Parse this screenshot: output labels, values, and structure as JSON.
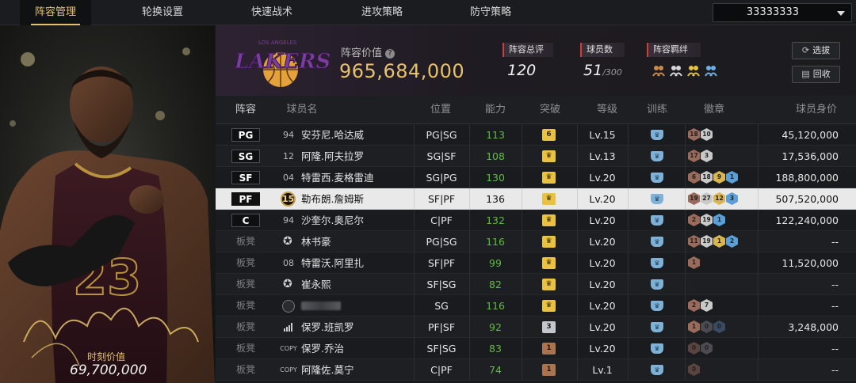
{
  "tabs": [
    {
      "label": "阵容管理",
      "active": true
    },
    {
      "label": "轮换设置",
      "active": false
    },
    {
      "label": "快速战术",
      "active": false
    },
    {
      "label": "进攻策略",
      "active": false
    },
    {
      "label": "防守策略",
      "active": false
    }
  ],
  "lineup_select": {
    "value": "33333333"
  },
  "featured_card": {
    "value_label": "时刻价值",
    "value": "69,700,000",
    "jersey": "23"
  },
  "team": {
    "logo_text": "LAKERS",
    "logo_sub": "LOS ANGELES",
    "lineup_value_label": "阵容价值",
    "lineup_value_help": "?",
    "lineup_value": "965,684,000",
    "rating_label": "阵容总评",
    "rating": "120",
    "player_count_label": "球员数",
    "player_count": "51",
    "player_count_max": "/300",
    "bonds_label": "阵容羁绊",
    "bond_icons": [
      "bond-icon-orange",
      "bond-icon-white",
      "bond-icon-gold",
      "bond-icon-blue"
    ]
  },
  "buttons": {
    "select_label": "选拔",
    "recycle_label": "回收"
  },
  "table": {
    "headers": {
      "lineup": "阵容",
      "name": "球员名",
      "position": "位置",
      "ability": "能力",
      "breakthrough": "突破",
      "level": "等级",
      "training": "训练",
      "badges": "徽章",
      "value": "球员身价"
    },
    "rows": [
      {
        "slot": "PG",
        "starter": true,
        "jersey": "94",
        "jersey_style": "plain",
        "name": "安芬尼.哈达威",
        "position": "PG|SG",
        "ability": "113",
        "break": "6",
        "break_style": "gold",
        "level": "Lv.15",
        "badges": [
          {
            "n": "18",
            "c": "#9a6a5a"
          },
          {
            "n": "10",
            "c": "#c9c9c9"
          }
        ],
        "value": "45,120,000"
      },
      {
        "slot": "SG",
        "starter": true,
        "jersey": "12",
        "jersey_style": "plain",
        "name": "阿隆.阿夫拉罗",
        "position": "SG|SF",
        "ability": "108",
        "break": "♛",
        "break_style": "gold",
        "level": "Lv.13",
        "badges": [
          {
            "n": "17",
            "c": "#9a6a5a"
          },
          {
            "n": "3",
            "c": "#c9c9c9"
          }
        ],
        "value": "17,536,000"
      },
      {
        "slot": "SF",
        "starter": true,
        "jersey": "04",
        "jersey_style": "plain",
        "name": "特雷西.麦格雷迪",
        "position": "SG|PG",
        "ability": "130",
        "break": "♛",
        "break_style": "gold",
        "level": "Lv.20",
        "badges": [
          {
            "n": "6",
            "c": "#9a6a5a"
          },
          {
            "n": "18",
            "c": "#c9c9c9"
          },
          {
            "n": "9",
            "c": "#d9b64f"
          },
          {
            "n": "1",
            "c": "#5a9fd6"
          }
        ],
        "value": "188,800,000"
      },
      {
        "slot": "PF",
        "starter": true,
        "selected": true,
        "jersey": "15",
        "jersey_style": "gold",
        "name": "勒布朗.詹姆斯",
        "position": "SF|PF",
        "ability": "136",
        "break": "♛",
        "break_style": "gold",
        "level": "Lv.20",
        "badges": [
          {
            "n": "19",
            "c": "#9a6a5a"
          },
          {
            "n": "27",
            "c": "#c9c9c9"
          },
          {
            "n": "12",
            "c": "#d9b64f"
          },
          {
            "n": "3",
            "c": "#5a9fd6"
          }
        ],
        "value": "507,520,000"
      },
      {
        "slot": "C",
        "starter": true,
        "jersey": "94",
        "jersey_style": "plain",
        "name": "沙奎尔.奥尼尔",
        "position": "C|PF",
        "ability": "132",
        "break": "♛",
        "break_style": "gold",
        "level": "Lv.20",
        "badges": [
          {
            "n": "2",
            "c": "#9a6a5a"
          },
          {
            "n": "19",
            "c": "#c9c9c9"
          },
          {
            "n": "1",
            "c": "#5a9fd6"
          }
        ],
        "value": "122,240,000"
      },
      {
        "slot": "板凳",
        "starter": false,
        "jersey": "",
        "jersey_style": "star",
        "name": "林书豪",
        "position": "PG|SG",
        "ability": "116",
        "break": "♛",
        "break_style": "gold",
        "level": "Lv.20",
        "badges": [
          {
            "n": "11",
            "c": "#9a6a5a"
          },
          {
            "n": "19",
            "c": "#c9c9c9"
          },
          {
            "n": "1",
            "c": "#d9b64f"
          },
          {
            "n": "2",
            "c": "#5a9fd6"
          }
        ],
        "value": "--"
      },
      {
        "slot": "板凳",
        "starter": false,
        "jersey": "08",
        "jersey_style": "plain",
        "name": "特雷沃.阿里扎",
        "position": "SF|PF",
        "ability": "99",
        "break": "♛",
        "break_style": "gold",
        "level": "Lv.20",
        "badges": [
          {
            "n": "1",
            "c": "#9a6a5a"
          }
        ],
        "value": "11,520,000"
      },
      {
        "slot": "板凳",
        "starter": false,
        "jersey": "",
        "jersey_style": "star",
        "name": "崔永熙",
        "position": "SF|SG",
        "ability": "82",
        "break": "♛",
        "break_style": "gold",
        "level": "Lv.20",
        "badges": [],
        "value": "--"
      },
      {
        "slot": "板凳",
        "starter": false,
        "jersey": "",
        "jersey_style": "user",
        "name": "",
        "position": "SG",
        "ability": "116",
        "break": "♛",
        "break_style": "gold",
        "level": "Lv.20",
        "badges": [
          {
            "n": "2",
            "c": "#9a6a5a"
          },
          {
            "n": "7",
            "c": "#c9c9c9"
          }
        ],
        "value": "--"
      },
      {
        "slot": "板凳",
        "starter": false,
        "jersey": "",
        "jersey_style": "bars",
        "name": "保罗.班凯罗",
        "position": "PF|SF",
        "ability": "92",
        "break": "3",
        "break_style": "silver",
        "level": "Lv.20",
        "badges": [
          {
            "n": "1",
            "c": "#9a6a5a"
          },
          {
            "n": "0",
            "c": "#4a4c52"
          },
          {
            "n": "0",
            "c": "#3a4a60"
          }
        ],
        "value": "3,248,000"
      },
      {
        "slot": "板凳",
        "starter": false,
        "jersey": "COPY",
        "jersey_style": "copy",
        "name": "保罗.乔治",
        "position": "SF|SG",
        "ability": "83",
        "break": "1",
        "break_style": "bronze",
        "level": "Lv.20",
        "badges": [
          {
            "n": "0",
            "c": "#5a4440"
          },
          {
            "n": "0",
            "c": "#4a4c52"
          }
        ],
        "value": "--"
      },
      {
        "slot": "板凳",
        "starter": false,
        "jersey": "COPY",
        "jersey_style": "copy",
        "name": "阿隆佐.莫宁",
        "position": "C|PF",
        "ability": "74",
        "break": "1",
        "break_style": "bronze",
        "level": "Lv.1",
        "badges": [
          {
            "n": "0",
            "c": "#5a4440"
          }
        ],
        "value": "--"
      }
    ]
  }
}
